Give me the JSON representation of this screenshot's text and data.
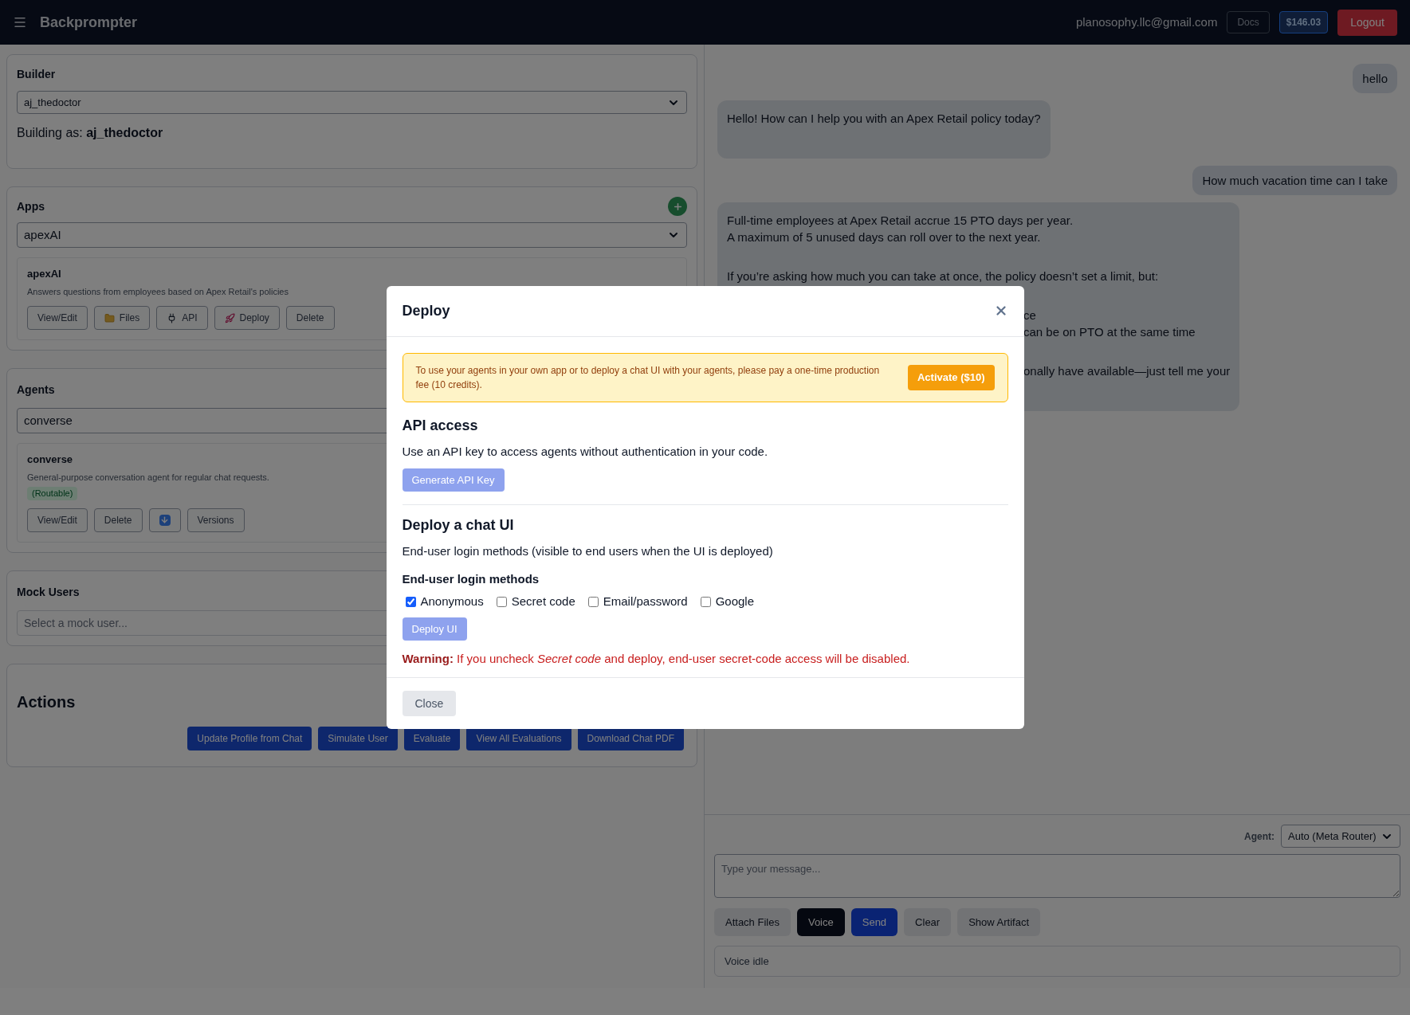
{
  "header": {
    "title": "Backprompter",
    "email": "planosophy.llc@gmail.com",
    "docs": "Docs",
    "balance": "$146.03",
    "logout": "Logout"
  },
  "builder": {
    "heading": "Builder",
    "select_value": "aj_thedoctor",
    "building_as": "Building as: **aj_thedoctor**"
  },
  "apps": {
    "heading": "Apps",
    "select_value": "apexAI",
    "card": {
      "title": "apexAI",
      "description": "Answers questions from employees based on Apex Retail's policies",
      "buttons": [
        {
          "kind": "plain",
          "label": "View/Edit"
        },
        {
          "kind": "folder",
          "label": "Files"
        },
        {
          "kind": "plug",
          "label": "API"
        },
        {
          "kind": "rocket",
          "label": "Deploy"
        },
        {
          "kind": "plain",
          "label": "Delete"
        }
      ]
    }
  },
  "agents": {
    "heading": "Agents",
    "select_value": "converse",
    "card": {
      "title": "converse",
      "description": "General-purpose conversation agent for regular chat requests.",
      "tag": "(Routable)",
      "buttons": [
        {
          "kind": "plain",
          "label": "View/Edit"
        },
        {
          "kind": "plain",
          "label": "Delete"
        },
        {
          "kind": "download"
        },
        {
          "kind": "plain",
          "label": "Versions"
        }
      ]
    }
  },
  "mock_users": {
    "heading": "Mock Users",
    "placeholder": "Select a mock user..."
  },
  "actions": {
    "heading": "Actions",
    "buttons": [
      "Update Profile from Chat",
      "Simulate User",
      "Evaluate",
      "View All Evaluations",
      "Download Chat PDF"
    ]
  },
  "chat": {
    "messages": [
      {
        "kind": "user",
        "lines": [
          {
            "kind": "line",
            "text": "hello"
          }
        ]
      },
      {
        "kind": "assistant",
        "lines": [
          {
            "kind": "line",
            "text": "Hello! How can I help you with an Apex Retail policy today?"
          },
          {
            "kind": "gap"
          }
        ]
      },
      {
        "kind": "user",
        "lines": [
          {
            "kind": "line",
            "text": "How much vacation time can I take"
          }
        ]
      },
      {
        "kind": "assistant",
        "lines": [
          {
            "kind": "line",
            "text": "Full-time employees at Apex Retail accrue 15 PTO days per year."
          },
          {
            "kind": "line",
            "text": "A maximum of 5 unused days can roll over to the next year."
          },
          {
            "kind": "gap"
          },
          {
            "kind": "line",
            "text": "If you’re asking how much you can take at once, the policy doesn’t set a limit, but:"
          },
          {
            "kind": "gap"
          },
          {
            "kind": "fragment",
            "text": "ce"
          },
          {
            "kind": "fragment",
            "text": "can be on PTO at the same time"
          },
          {
            "kind": "gap"
          },
          {
            "kind": "fragment",
            "text": "onally have available—just tell me your"
          },
          {
            "kind": "gap"
          }
        ]
      }
    ]
  },
  "composer": {
    "agent_label": "Agent:",
    "agent_value": "Auto (Meta Router)",
    "placeholder": "Type your message...",
    "buttons": [
      {
        "kind": "secondary",
        "label": "Attach Files"
      },
      {
        "kind": "dark",
        "label": "Voice"
      },
      {
        "kind": "primary",
        "label": "Send"
      },
      {
        "kind": "secondary",
        "label": "Clear"
      },
      {
        "kind": "secondary",
        "label": "Show Artifact"
      }
    ],
    "status": "Voice idle"
  },
  "modal": {
    "title": "Deploy",
    "notice": "To use your agents in your own app or to deploy a chat UI with your agents, please pay a one-time production fee (10 credits).",
    "activate": "Activate ($10)",
    "api_heading": "API access",
    "api_text": "Use an API key to access agents without authentication in your code.",
    "api_button": {
      "label": "Generate API Key",
      "disabled": true
    },
    "deploy_heading": "Deploy a chat UI",
    "deploy_text": "End-user login methods (visible to end users when the UI is deployed)",
    "methods_heading": "End-user login methods",
    "methods": [
      {
        "label": "Anonymous",
        "checked": true
      },
      {
        "label": "Secret code",
        "checked": false
      },
      {
        "label": "Email/password",
        "checked": false
      },
      {
        "label": "Google",
        "checked": false
      }
    ],
    "deploy_button": {
      "label": "Deploy UI",
      "disabled": true
    },
    "warning": "**Warning:** If you uncheck *Secret code* and deploy, end-user secret-code access will be disabled.",
    "close": "Close"
  }
}
